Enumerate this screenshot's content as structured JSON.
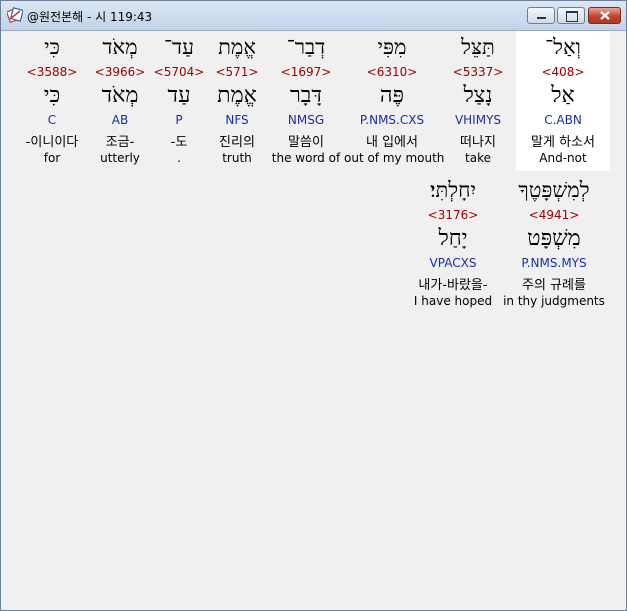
{
  "window": {
    "title": "@원전본해 - 시 119:43"
  },
  "colors": {
    "strong": "#a00000",
    "morph": "#1c2ea8",
    "selected_bg": "#ffffff"
  },
  "icons": {
    "app": "app-icon",
    "minimize": "minimize-icon",
    "maximize": "maximize-icon",
    "close": "close-icon"
  },
  "rows": [
    {
      "words": [
        {
          "hebrew": "וְאַל־",
          "strong": "<408>",
          "lemma": "אַל",
          "morph": "C.ABN",
          "korean": "말게 하소서",
          "english": "And-not",
          "selected": true
        },
        {
          "hebrew": "תַּצֵּל",
          "strong": "<5337>",
          "lemma": "נָצַל",
          "morph": "VHIMYS",
          "korean": "떠나지",
          "english": "take"
        },
        {
          "hebrew": "מִפִּי",
          "strong": "<6310>",
          "lemma": "פֶּה",
          "morph": "P.NMS.CXS",
          "korean": "내 입에서",
          "english": "out of my mouth"
        },
        {
          "hebrew": "דְבַר־",
          "strong": "<1697>",
          "lemma": "דָּבָר",
          "morph": "NMSG",
          "korean": "말씀이",
          "english": "the word of"
        },
        {
          "hebrew": "אֱמֶת",
          "strong": "<571>",
          "lemma": "אֱמֶת",
          "morph": "NFS",
          "korean": "진리의",
          "english": "truth"
        },
        {
          "hebrew": "עַד־",
          "strong": "<5704>",
          "lemma": "עַד",
          "morph": "P",
          "korean": "-도",
          "english": "."
        },
        {
          "hebrew": "מְאֹד",
          "strong": "<3966>",
          "lemma": "מְאֹד",
          "morph": "AB",
          "korean": "조금-",
          "english": "utterly"
        },
        {
          "hebrew": "כִּי",
          "strong": "<3588>",
          "lemma": "כִּי",
          "morph": "C",
          "korean": "-이니이다",
          "english": "for"
        }
      ]
    },
    {
      "words": [
        {
          "hebrew": "לְמִשְׁפָּטֶךָ",
          "strong": "<4941>",
          "lemma": "מִשְׁפָּט",
          "morph": "P.NMS.MYS",
          "korean": "주의 규례를",
          "english": "in thy judgments"
        },
        {
          "hebrew": "יִחָלְתִּי׃",
          "strong": "<3176>",
          "lemma": "יָחַל",
          "morph": "VPACXS",
          "korean": "내가-바랐을-",
          "english": "I have hoped"
        }
      ]
    }
  ]
}
